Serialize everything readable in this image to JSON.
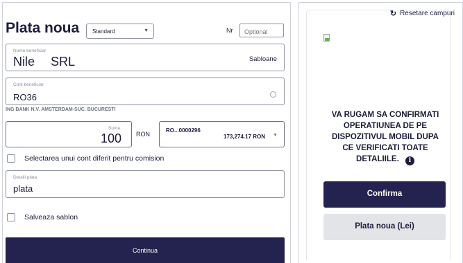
{
  "header": {
    "reset_icon": "refresh-icon",
    "reset_label": "Resetare campuri",
    "title": "Plata noua",
    "type_select_value": "Standard",
    "nr_label": "Nr",
    "nr_placeholder": "Optional"
  },
  "beneficiary": {
    "name_label": "Nume beneficiar",
    "name_value": "Nile SRL",
    "templates_link": "Sabloane",
    "account_label": "Cont beneficiar",
    "account_value": "RO36",
    "bank_name": "ING BANK N.V. AMSTERDAM-SUC. BUCURESTI"
  },
  "amount": {
    "label": "Suma",
    "value": "100",
    "currency": "RON",
    "source_account": "RO...0000296",
    "source_balance": "173,274.17 RON"
  },
  "options": {
    "commission_account_label": "Selectarea unui cont diferit pentru comision",
    "details_label": "Detalii plata",
    "details_value": "plata",
    "save_template_label": "Salveaza sablon"
  },
  "actions": {
    "continue_label": "Continua"
  },
  "confirm_panel": {
    "message": "VA RUGAM SA CONFIRMATI OPERATIUNEA DE PE DISPOZITIVUL MOBIL DUPA CE VERIFICATI TOATE DETALIILE.",
    "info_icon": "info-icon",
    "confirm_label": "Confirma",
    "new_payment_label": "Plata noua (Lei)"
  },
  "colors": {
    "primary": "#24224e",
    "secondary_button": "#e3e4e7",
    "border": "#8e92a2"
  }
}
